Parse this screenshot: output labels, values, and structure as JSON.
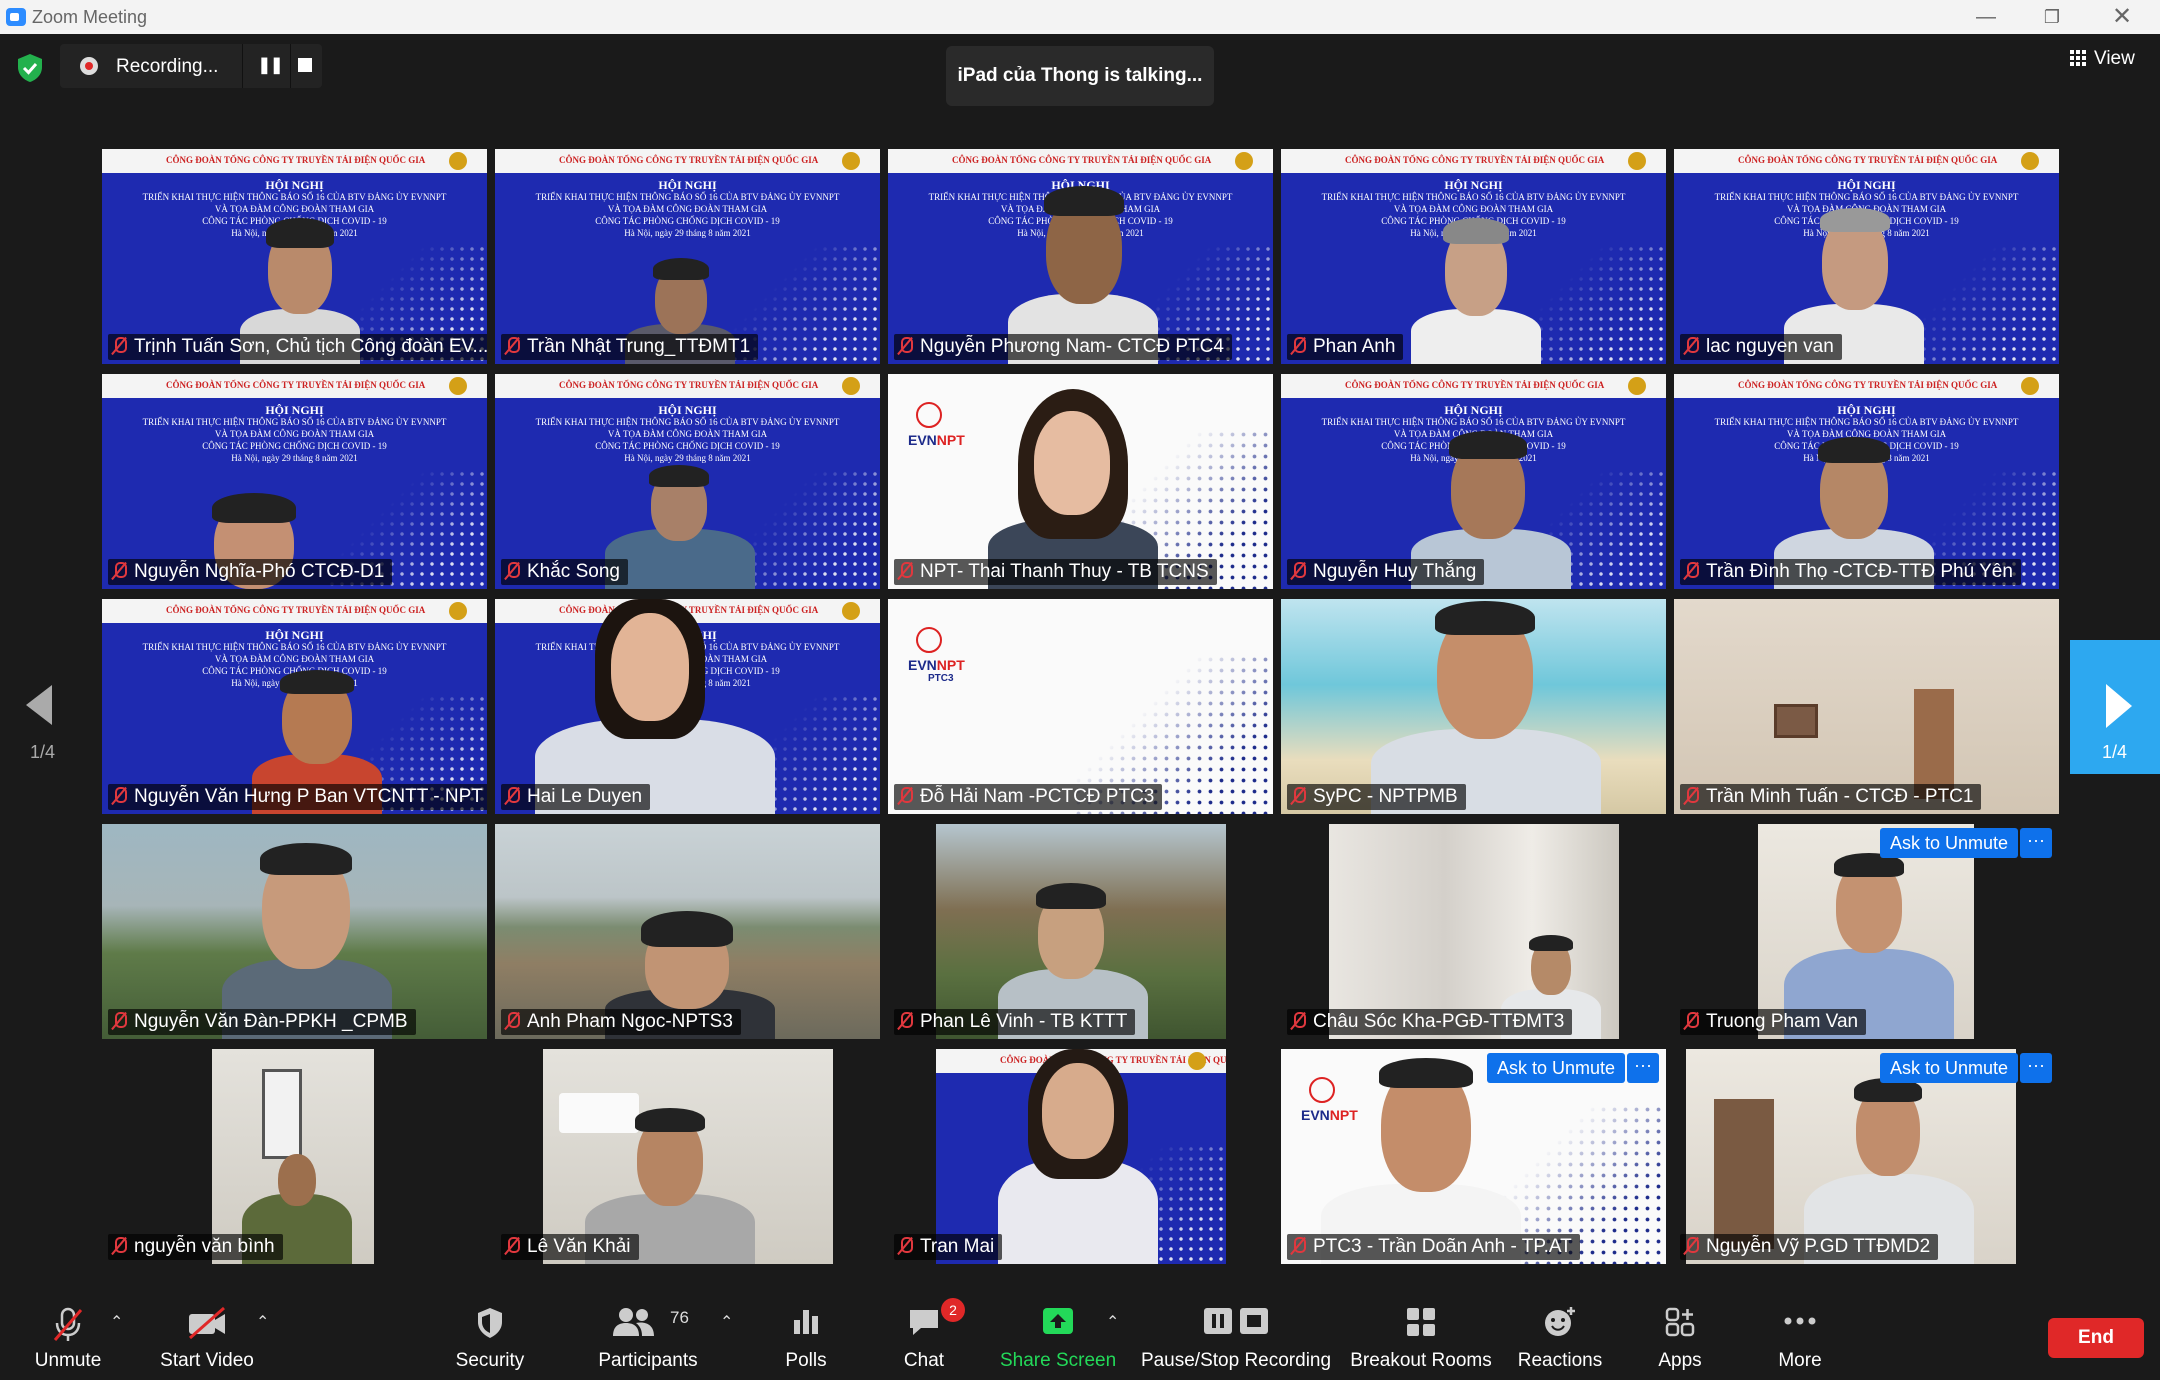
{
  "window": {
    "title": "Zoom Meeting"
  },
  "topbar": {
    "recording_label": "Recording...",
    "talking_text": "iPad của Thong is talking...",
    "view_label": "View"
  },
  "slide": {
    "header": "CÔNG ĐOÀN TỔNG CÔNG TY TRUYỀN TẢI ĐIỆN QUỐC GIA",
    "title": "HỘI NGHỊ",
    "line1": "TRIỂN KHAI THỰC HIỆN THÔNG BÁO SỐ 16 CỦA BTV ĐẢNG ỦY EVNNPT",
    "line2": "VÀ TỌA ĐÀM CÔNG ĐOÀN THAM GIA",
    "line3": "CÔNG TÁC PHÒNG CHỐNG DỊCH COVID - 19",
    "date": "Hà Nội, ngày 29 tháng 8 năm 2021"
  },
  "logo": {
    "evn": "EVN",
    "npt": "NPT",
    "ptc3": "PTC3"
  },
  "participants": [
    {
      "name": "Trịnh Tuấn Sơn, Chủ tịch Công đoàn EV..."
    },
    {
      "name": "Trần Nhật Trung_TTĐMT1"
    },
    {
      "name": "Nguyễn Phương Nam- CTCĐ PTC4"
    },
    {
      "name": "Phan Anh"
    },
    {
      "name": "lac nguyen van"
    },
    {
      "name": "Nguyễn Nghĩa-Phó CTCĐ-D1"
    },
    {
      "name": "Khắc Song"
    },
    {
      "name": "NPT- Thai Thanh Thuy - TB TCNS"
    },
    {
      "name": "Nguyễn Huy Thắng"
    },
    {
      "name": "Trần Đình Thọ -CTCĐ-TTĐ Phú Yên"
    },
    {
      "name": "Nguyễn Văn Hưng P Ban VTCNTT - NPT"
    },
    {
      "name": "Hai Le Duyen"
    },
    {
      "name": "Đỗ Hải Nam -PCTCĐ PTC3"
    },
    {
      "name": "SyPC - NPTPMB"
    },
    {
      "name": "Trần Minh Tuấn - CTCĐ - PTC1"
    },
    {
      "name": "Nguyễn Văn Đàn-PPKH _CPMB"
    },
    {
      "name": "Anh Pham Ngoc-NPTS3"
    },
    {
      "name": "Phan Lê Vinh - TB KTTT"
    },
    {
      "name": "Châu Sóc Kha-PGĐ-TTĐMT3"
    },
    {
      "name": "Truong Pham Van",
      "ask_unmute": "Ask to Unmute",
      "more": "···"
    },
    {
      "name": "nguyễn văn bình"
    },
    {
      "name": "Lê Văn Khải"
    },
    {
      "name": "Tran Mai"
    },
    {
      "name": "PTC3 - Trần Doãn Anh - TP.AT",
      "ask_unmute": "Ask to Unmute",
      "more": "···"
    },
    {
      "name": "Nguyễn Vỹ P.GD TTĐMD2",
      "ask_unmute": "Ask to Unmute",
      "more": "···"
    }
  ],
  "pager": {
    "left_label": "1/4",
    "right_label": "1/4"
  },
  "toolbar": {
    "unmute": "Unmute",
    "start_video": "Start Video",
    "security": "Security",
    "participants": "Participants",
    "participants_count": "76",
    "polls": "Polls",
    "chat": "Chat",
    "chat_badge": "2",
    "share_screen": "Share Screen",
    "pause_stop_recording": "Pause/Stop Recording",
    "breakout_rooms": "Breakout Rooms",
    "reactions": "Reactions",
    "apps": "Apps",
    "more": "More",
    "end": "End"
  },
  "colors": {
    "accent": "#0e71eb",
    "share_green": "#23d959",
    "end_red": "#e02828",
    "slide_blue": "#1e2ab0"
  }
}
